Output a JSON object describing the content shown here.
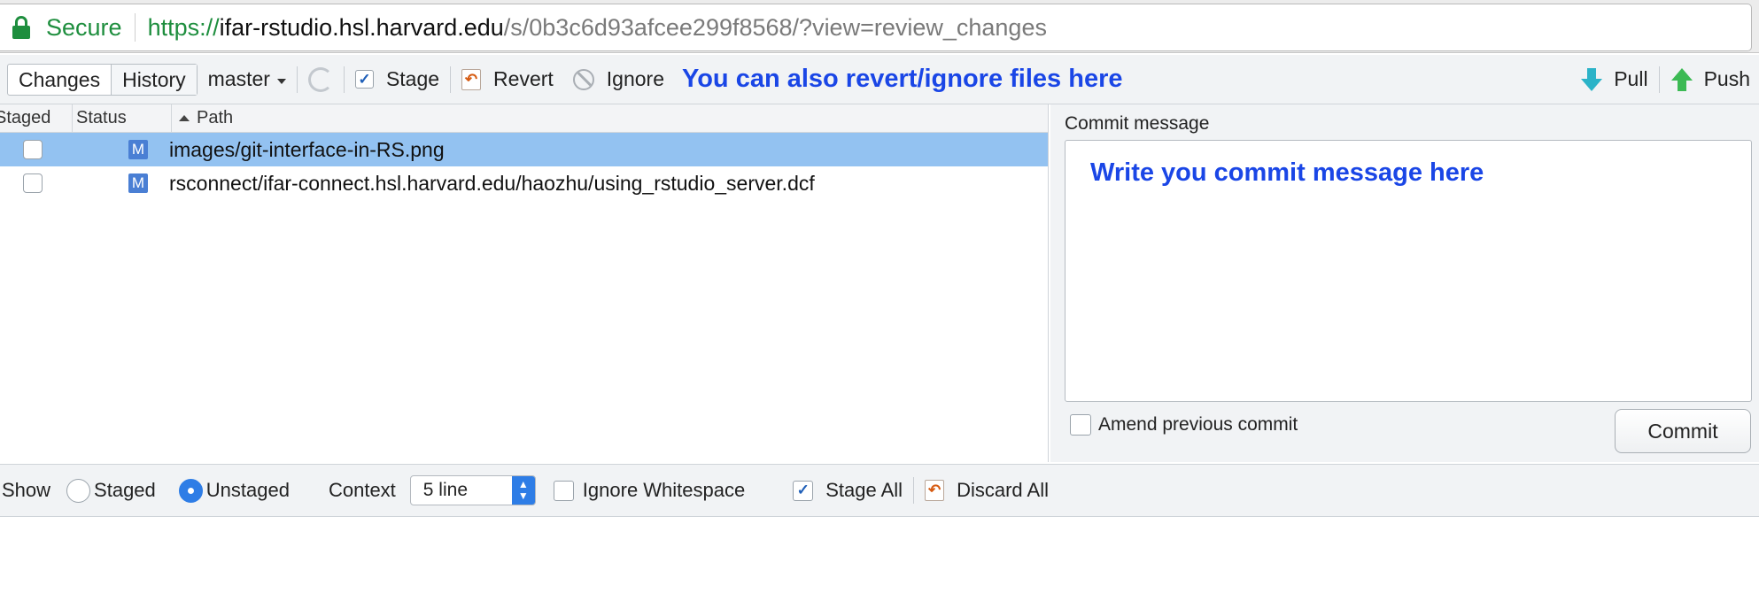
{
  "browser": {
    "secure_label": "Secure",
    "url_scheme": "https://",
    "url_host": "ifar-rstudio.hsl.harvard.edu",
    "url_path": "/s/0b3c6d93afcee299f8568/?view=review_changes"
  },
  "toolbar": {
    "tabs": [
      "Changes",
      "History"
    ],
    "branch": "master",
    "stage_label": "Stage",
    "revert_label": "Revert",
    "ignore_label": "Ignore",
    "annotation": "You can also revert/ignore files here",
    "pull_label": "Pull",
    "push_label": "Push"
  },
  "file_list": {
    "headers": {
      "staged": "Staged",
      "status": "Status",
      "path": "Path"
    },
    "rows": [
      {
        "staged": false,
        "status": "M",
        "path": "images/git-interface-in-RS.png",
        "selected": true
      },
      {
        "staged": false,
        "status": "M",
        "path": "rsconnect/ifar-connect.hsl.harvard.edu/haozhu/using_rstudio_server.dcf",
        "selected": false
      }
    ]
  },
  "commit": {
    "label": "Commit message",
    "annotation": "Write you commit message here",
    "amend_label": "Amend previous commit",
    "button_label": "Commit"
  },
  "diff_options": {
    "show_label": "Show",
    "staged_label": "Staged",
    "unstaged_label": "Unstaged",
    "selected_view": "Unstaged",
    "context_label": "Context",
    "context_value": "5 line",
    "ignore_whitespace_label": "Ignore Whitespace",
    "stage_all_label": "Stage All",
    "discard_all_label": "Discard All"
  },
  "colors": {
    "secure_green": "#1e8e3e",
    "annotation_blue": "#1a46e6",
    "selection": "#93c2f1",
    "status_badge": "#4a7fd4"
  }
}
